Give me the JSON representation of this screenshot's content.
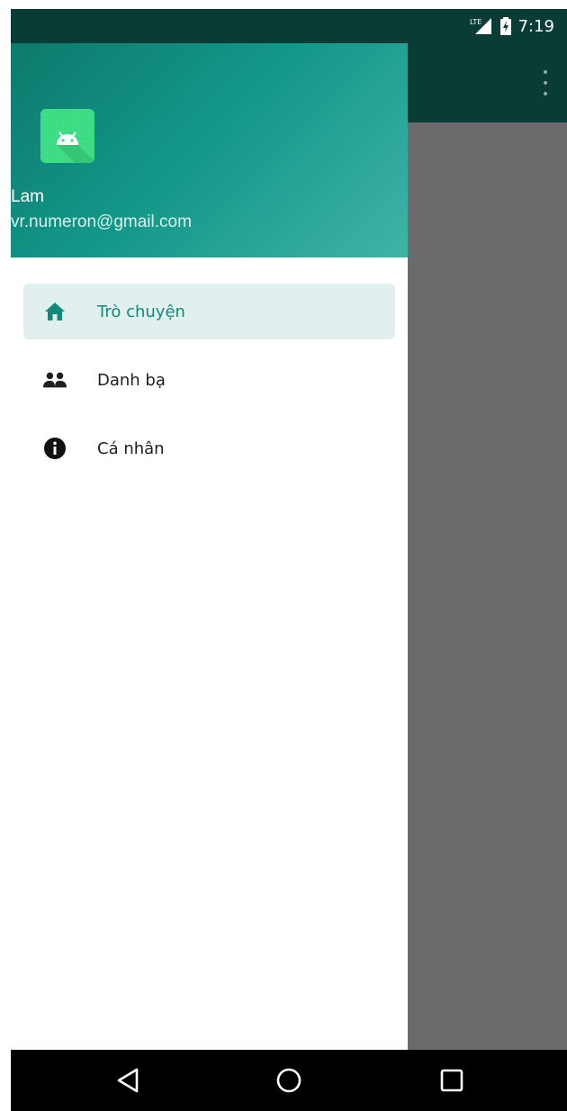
{
  "status_bar": {
    "network_icon": "lte-signal-icon",
    "battery_icon": "battery-charging-icon",
    "time": "7:19"
  },
  "app_bar": {
    "overflow_icon": "more-vert-icon"
  },
  "drawer": {
    "header": {
      "avatar_icon": "android-icon",
      "user_name": "Lam",
      "user_email": "vr.numeron@gmail.com"
    },
    "items": [
      {
        "label": "Trò chuyện",
        "icon": "home-icon",
        "active": true
      },
      {
        "label": "Danh bạ",
        "icon": "contacts-icon",
        "active": false
      },
      {
        "label": "Cá nhân",
        "icon": "info-icon",
        "active": false
      }
    ]
  },
  "nav_bar": {
    "back_icon": "back-triangle-icon",
    "home_icon": "home-circle-icon",
    "recents_icon": "recents-square-icon"
  },
  "colors": {
    "primary": "#129688",
    "primary_dark": "#0a3c36",
    "active_bg": "#e1f0ee",
    "scrim": "#6b6b6b"
  }
}
